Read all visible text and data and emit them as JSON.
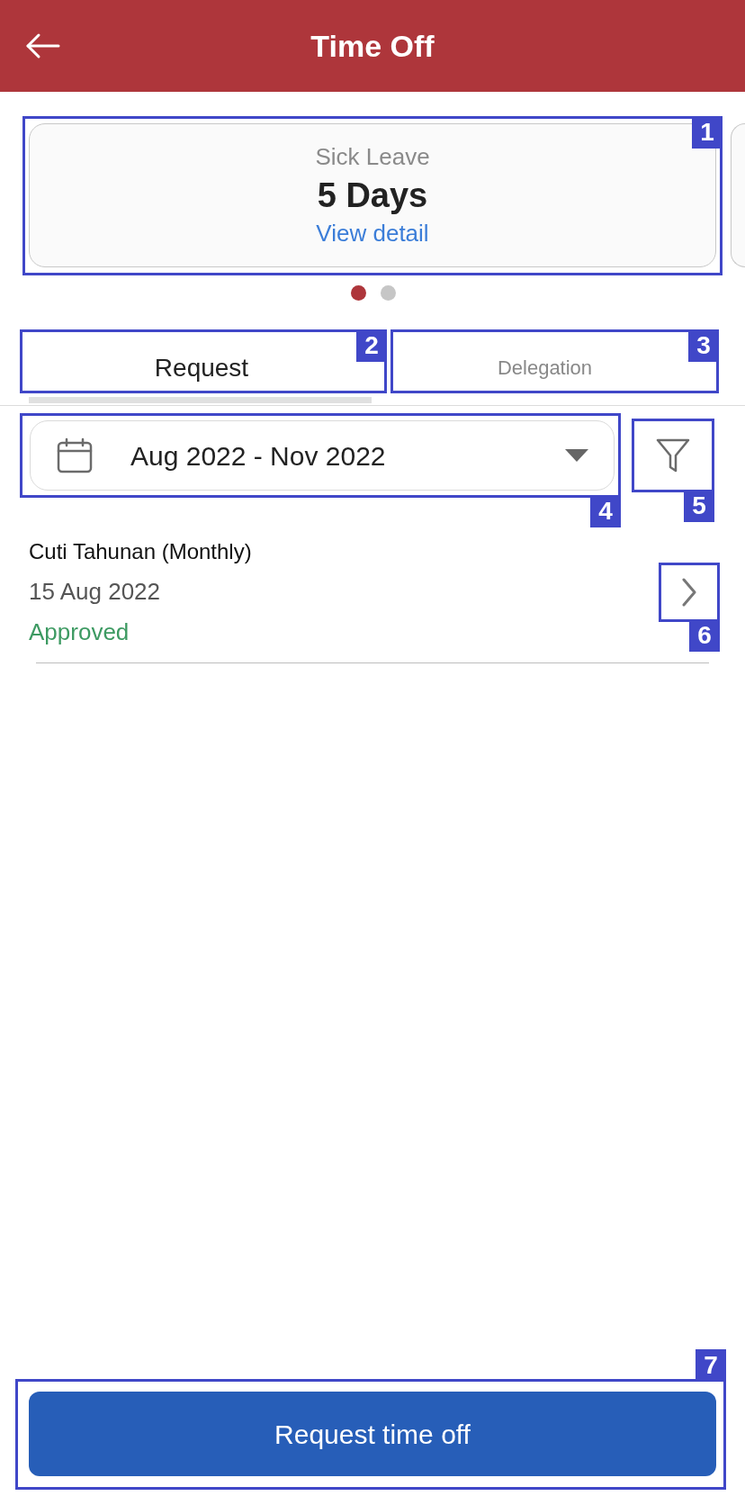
{
  "header": {
    "title": "Time Off"
  },
  "balance_cards": [
    {
      "type": "Sick Leave",
      "amount": "5 Days",
      "link": "View detail",
      "marker": "1"
    }
  ],
  "pager": [
    {
      "selected": true
    },
    {
      "selected": false
    }
  ],
  "tabs": [
    {
      "label": "Request",
      "selected": true,
      "marker": "2"
    },
    {
      "label": "Delegation",
      "selected": false,
      "marker": "3"
    }
  ],
  "date_range": {
    "value": "Aug 2022 - Nov 2022",
    "marker": "4"
  },
  "filter_button": {
    "marker": "5"
  },
  "requests": [
    {
      "title": "Cuti Tahunan (Monthly)",
      "date": "15 Aug 2022",
      "status": "Approved",
      "color": "#3d9a62",
      "marker": "6"
    }
  ],
  "primary_button": {
    "label": "Request time off",
    "marker": "7"
  }
}
